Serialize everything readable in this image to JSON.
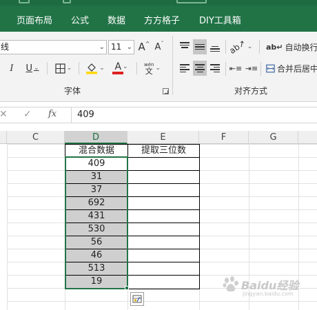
{
  "menu": {
    "tabs": [
      "页面布局",
      "公式",
      "数据",
      "方方格子",
      "DIY工具箱"
    ]
  },
  "ribbon": {
    "font_name": "线",
    "font_size": "11",
    "grow_font": "A",
    "shrink_font": "A",
    "italic": "I",
    "underline": "U",
    "font_color_letter": "A",
    "phonetic_top": "wén",
    "phonetic_bottom": "文",
    "wrap_text": "自动换行",
    "merge_center": "合并后居中",
    "group_font": "字体",
    "group_alignment": "对齐方式"
  },
  "formula_bar": {
    "fx_label": "fx",
    "value": "409"
  },
  "grid": {
    "columns": [
      "C",
      "D",
      "E",
      "F",
      "G"
    ],
    "header_d": "混合数据",
    "header_e": "提取三位数",
    "values": [
      "409",
      "31",
      "37",
      "692",
      "431",
      "530",
      "56",
      "46",
      "513",
      "19"
    ]
  },
  "watermark": {
    "text": "Baidu经验",
    "subtext": "jingyan.baidu.com"
  },
  "colors": {
    "excel_green": "#217346",
    "selection_fill": "#cfcfcf",
    "font_red": "#e02020",
    "highlight_yellow": "#ffd800"
  }
}
